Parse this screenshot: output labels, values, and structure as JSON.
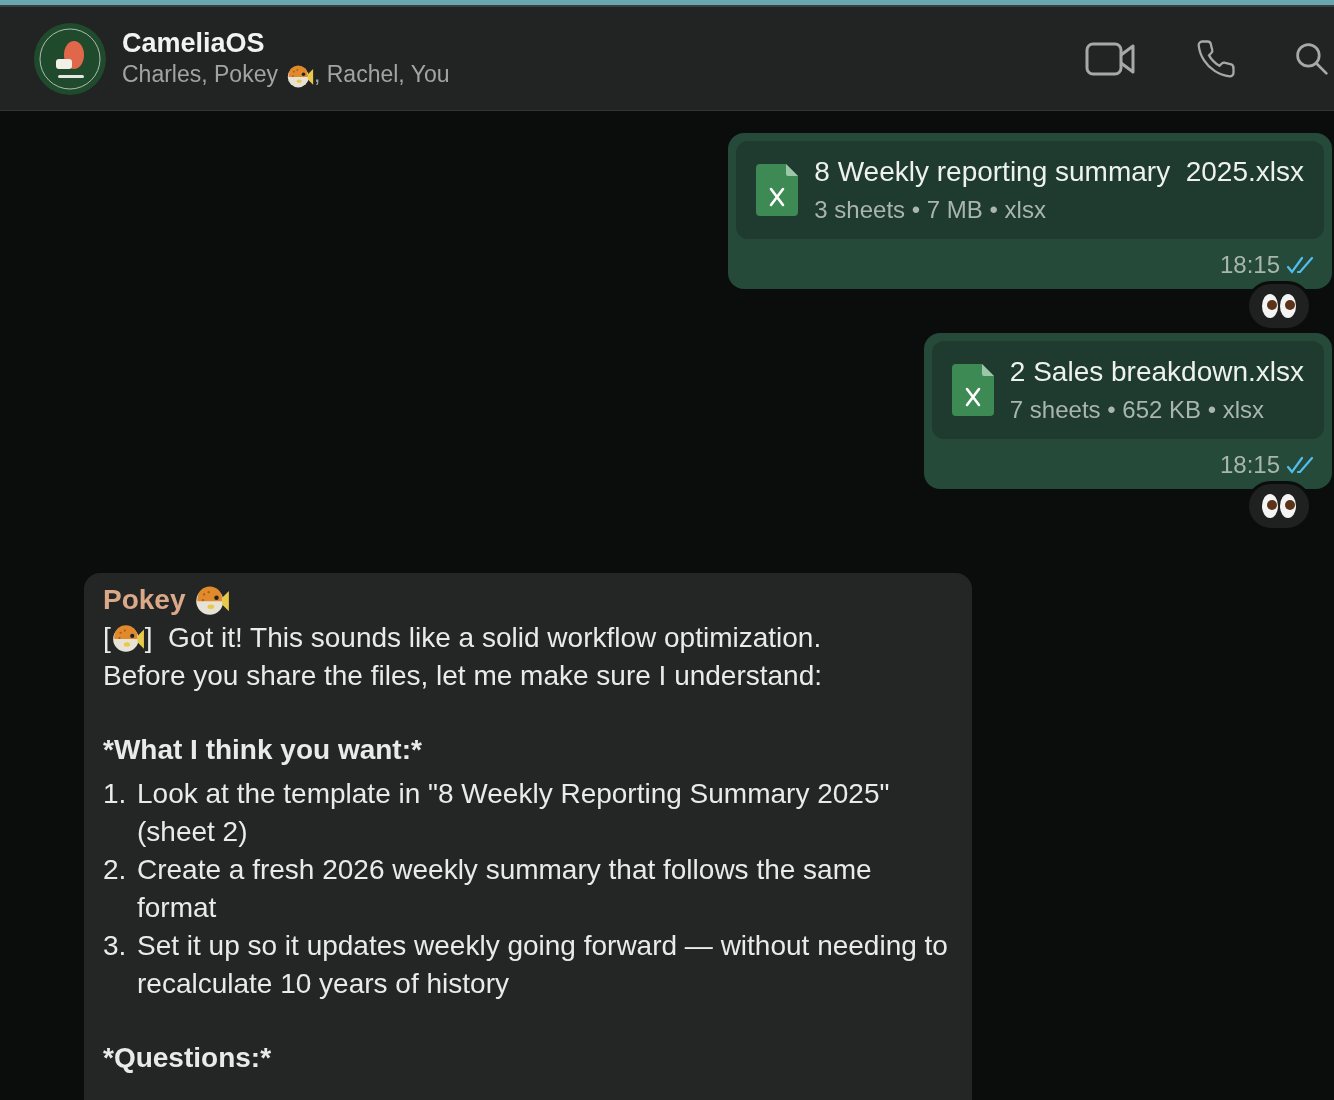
{
  "header": {
    "title": "CameliaOS",
    "subtitle_before": "Charles, Pokey",
    "subtitle_after": ", Rachel, You"
  },
  "messages": [
    {
      "kind": "file",
      "file_name": "8 Weekly reporting summary  2025.xlsx",
      "meta": "3 sheets • 7 MB • xlsx",
      "time": "18:15",
      "read": true
    },
    {
      "kind": "file",
      "file_name": "2 Sales breakdown.xlsx",
      "meta": "7 sheets • 652 KB • xlsx",
      "time": "18:15",
      "read": true
    },
    {
      "kind": "text",
      "sender": "Pokey",
      "intro_before": "[",
      "intro_after": "]  Got it! This sounds like a solid workflow optimization.",
      "intro_line2": "Before you share the files, let me make sure I understand:",
      "heading": "*What I think you want:*",
      "items": [
        {
          "number": "1.",
          "text": "Look at the template in \"8 Weekly Reporting Summary 2025\" (sheet 2)"
        },
        {
          "number": "2.",
          "text": "Create a fresh 2026 weekly summary that follows the same format"
        },
        {
          "number": "3.",
          "text": "Set it up so it updates weekly going forward — without needing to recalculate 10 years of history"
        }
      ],
      "trailing": "*Questions:*"
    }
  ]
}
